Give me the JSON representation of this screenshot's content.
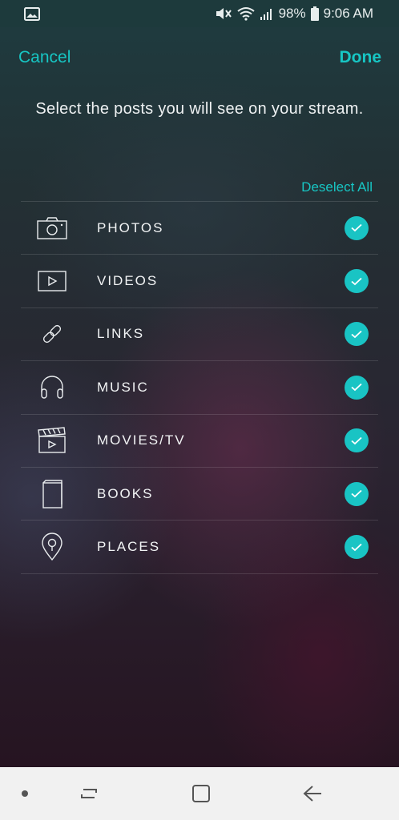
{
  "status_bar": {
    "battery": "98%",
    "time": "9:06 AM",
    "icons": [
      "image-notification-icon",
      "mute-icon",
      "wifi-icon",
      "signal-icon",
      "battery-icon"
    ]
  },
  "header": {
    "cancel_label": "Cancel",
    "done_label": "Done"
  },
  "instructions": "Select the posts you will see on your stream.",
  "deselect_all_label": "Deselect All",
  "categories": [
    {
      "label": "PHOTOS",
      "icon": "camera-icon",
      "checked": true
    },
    {
      "label": "VIDEOS",
      "icon": "video-play-icon",
      "checked": true
    },
    {
      "label": "LINKS",
      "icon": "link-icon",
      "checked": true
    },
    {
      "label": "MUSIC",
      "icon": "headphones-icon",
      "checked": true
    },
    {
      "label": "MOVIES/TV",
      "icon": "clapperboard-icon",
      "checked": true
    },
    {
      "label": "BOOKS",
      "icon": "book-icon",
      "checked": true
    },
    {
      "label": "PLACES",
      "icon": "map-pin-icon",
      "checked": true
    }
  ],
  "colors": {
    "accent": "#17c6c4",
    "check_fill": "#19c4c4"
  },
  "nav_bar": {
    "icons": [
      "dot-icon",
      "recent-apps-icon",
      "home-icon",
      "back-icon"
    ]
  }
}
